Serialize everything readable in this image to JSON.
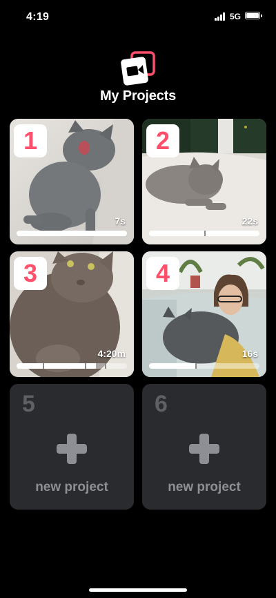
{
  "status_bar": {
    "time": "4:19",
    "network": "5G"
  },
  "header": {
    "title": "My Projects",
    "logo_icon": "video-camera-icon"
  },
  "colors": {
    "accent": "#ff4f6b",
    "card_bg": "#2a2b2e",
    "muted": "#8d8f94"
  },
  "projects": [
    {
      "number": "1",
      "duration": "7s",
      "progress": 1.0,
      "segments": []
    },
    {
      "number": "2",
      "duration": "22s",
      "progress": 1.0,
      "segments": [
        0.5
      ]
    },
    {
      "number": "3",
      "duration": "4:20m",
      "progress": 0.72,
      "segments": [
        0.24,
        0.62,
        0.8
      ]
    },
    {
      "number": "4",
      "duration": "16s",
      "progress": 0.42,
      "segments": [
        0.42
      ]
    }
  ],
  "new_projects": [
    {
      "number": "5",
      "label": "new project",
      "icon": "plus-icon"
    },
    {
      "number": "6",
      "label": "new project",
      "icon": "plus-icon"
    }
  ]
}
